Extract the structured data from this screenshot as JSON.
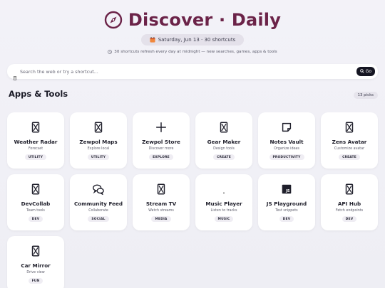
{
  "header": {
    "title": "Discover · Daily",
    "icon": "compass-icon",
    "accent_color": "#6b2348",
    "date_label": "Saturday, Jun 13 · 30 shortcuts",
    "refresh_note": "30 shortcuts refresh every day at midnight — new searches, games, apps & tools"
  },
  "search": {
    "placeholder": "Search the web or try a shortcut...",
    "value": "",
    "go_label": "Go"
  },
  "section": {
    "title": "Apps & Tools",
    "count_label": "13 picks"
  },
  "cards": [
    {
      "name": "Weather Radar",
      "desc": "Forecast",
      "tag": "UTILITY",
      "icon": "hourglass-icon"
    },
    {
      "name": "Zewpol Maps",
      "desc": "Explore local",
      "tag": "UTILITY",
      "icon": "hourglass-icon"
    },
    {
      "name": "Zewpol Store",
      "desc": "Discover more",
      "tag": "EXPLORE",
      "icon": "plus-icon"
    },
    {
      "name": "Gear Maker",
      "desc": "Design tools",
      "tag": "CREATE",
      "icon": "hourglass-icon"
    },
    {
      "name": "Notes Vault",
      "desc": "Organize ideas",
      "tag": "PRODUCTIVITY",
      "icon": "note-icon"
    },
    {
      "name": "Zens Avatar",
      "desc": "Customize avatar",
      "tag": "CREATE",
      "icon": "hourglass-icon"
    },
    {
      "name": "DevCollab",
      "desc": "Team tools",
      "tag": "DEV",
      "icon": "hourglass-icon"
    },
    {
      "name": "Community Feed",
      "desc": "Collaborate",
      "tag": "SOCIAL",
      "icon": "chat-bubbles-icon"
    },
    {
      "name": "Stream TV",
      "desc": "Watch streams",
      "tag": "MEDIA",
      "icon": "hourglass-icon"
    },
    {
      "name": "Music Player",
      "desc": "Listen to tracks",
      "tag": "MUSIC",
      "icon": "dot-icon"
    },
    {
      "name": "JS Playground",
      "desc": "Test snippets",
      "tag": "DEV",
      "icon": "js-icon"
    },
    {
      "name": "API Hub",
      "desc": "Fetch endpoints",
      "tag": "DEV",
      "icon": "hourglass-icon"
    },
    {
      "name": "Car Mirror",
      "desc": "Drive view",
      "tag": "FUN",
      "icon": "hourglass-icon"
    }
  ]
}
